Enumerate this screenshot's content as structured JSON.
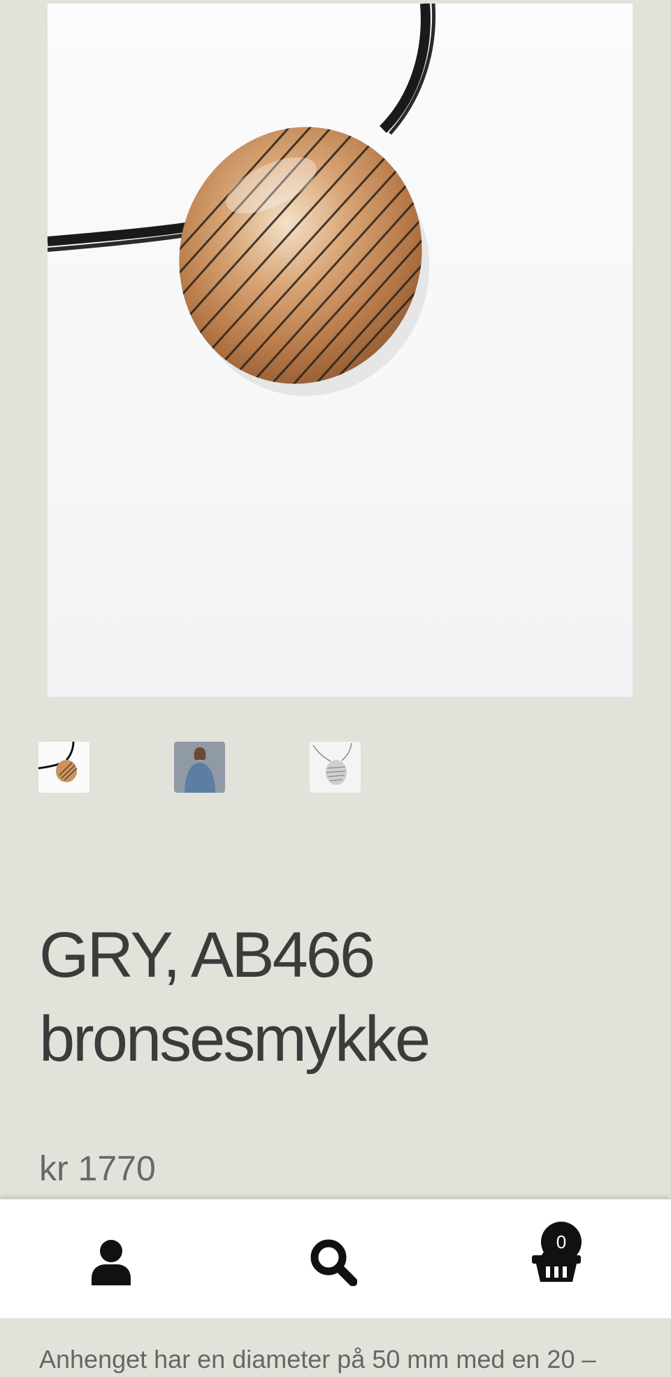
{
  "product": {
    "title_line1": "GRY, AB466",
    "title_line2": "bronsesmykke",
    "price": "kr 1770",
    "description": "Anhenget har en diameter på 50 mm med en 20 –"
  },
  "gallery": {
    "main_image": "bronze-pendant-photo",
    "thumbnails": [
      {
        "name": "thumbnail-bronze-pendant"
      },
      {
        "name": "thumbnail-model-photo"
      },
      {
        "name": "thumbnail-silver-pendant"
      }
    ]
  },
  "bottom_bar": {
    "account_icon": "user-icon",
    "search_icon": "search-icon",
    "cart_icon": "basket-icon",
    "cart_count": "0"
  },
  "colors": {
    "background": "#e3e2da",
    "title_text": "#3b3b3b",
    "bar_background": "#ffffff",
    "bronze": "#c8935e",
    "badge": "#111111"
  }
}
